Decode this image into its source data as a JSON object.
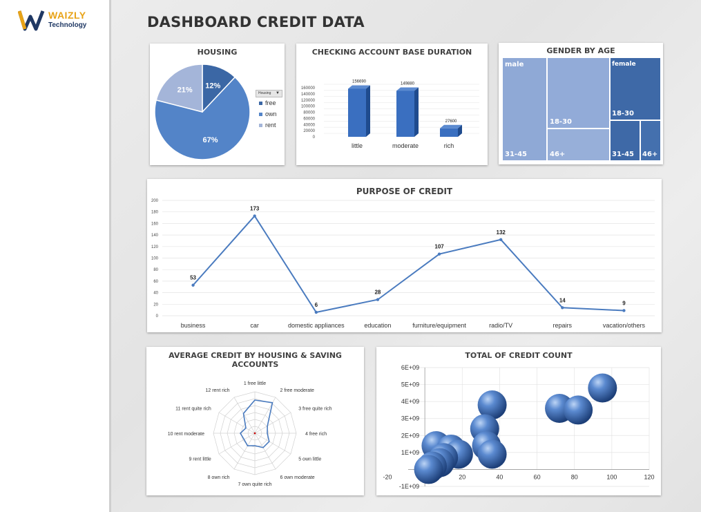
{
  "brand": {
    "name": "WAIZLY",
    "sub": "Technology"
  },
  "page_title": "DASHBOARD CREDIT DATA",
  "colors": {
    "dark_blue": "#3b67a5",
    "mid_blue": "#5384c8",
    "light_blue": "#a4b5d9",
    "line": "#4a7bbf"
  },
  "housing": {
    "title": "HOUSING",
    "filter_label": "Housing",
    "legend": [
      "free",
      "own",
      "rent"
    ]
  },
  "checking": {
    "title": "CHECKING ACCOUNT BASE DURATION"
  },
  "gender": {
    "title": "GENDER BY AGE",
    "labels": {
      "male": "male",
      "female": "female",
      "m_31_45": "31-45",
      "m_18_30": "18-30",
      "m_46": "46+",
      "f_18_30": "18-30",
      "f_31_45": "31-45",
      "f_46": "46+"
    }
  },
  "purpose": {
    "title": "PURPOSE OF CREDIT"
  },
  "radar": {
    "title_line1": "AVERAGE CREDIT BY HOUSING & SAVING",
    "title_line2": "ACCOUNTS"
  },
  "bubble": {
    "title": "TOTAL OF CREDIT COUNT"
  },
  "chart_data": [
    {
      "type": "pie",
      "title": "HOUSING",
      "categories": [
        "free",
        "own",
        "rent"
      ],
      "values": [
        12,
        67,
        21
      ],
      "labels": [
        "12%",
        "67%",
        "21%"
      ],
      "colors": [
        "#3b67a5",
        "#5384c8",
        "#a4b5d9"
      ],
      "legend": "right"
    },
    {
      "type": "bar",
      "title": "CHECKING ACCOUNT BASE DURATION",
      "categories": [
        "little",
        "moderate",
        "rich"
      ],
      "values": [
        156690,
        149880,
        27600
      ],
      "ylim": [
        0,
        160000
      ],
      "yticks": [
        0,
        20000,
        40000,
        60000,
        80000,
        100000,
        120000,
        140000,
        160000
      ],
      "grid": true
    },
    {
      "type": "line",
      "title": "PURPOSE OF CREDIT",
      "categories": [
        "business",
        "car",
        "domestic appliances",
        "education",
        "furniture/equipment",
        "radio/TV",
        "repairs",
        "vacation/others"
      ],
      "values": [
        53,
        173,
        6,
        28,
        107,
        132,
        14,
        9
      ],
      "ylim": [
        0,
        200
      ],
      "yticks": [
        0,
        20,
        40,
        60,
        80,
        100,
        120,
        140,
        160,
        180,
        200
      ],
      "grid": true
    },
    {
      "type": "radar",
      "title": "AVERAGE CREDIT BY HOUSING & SAVING ACCOUNTS",
      "categories": [
        "1 free little",
        "2 free moderate",
        "3 free quite rich",
        "4 free rich",
        "5 own little",
        "6 own moderate",
        "7 own quite rich",
        "8 own rich",
        "9 rent little",
        "10 rent moderate",
        "11 rent quite rich",
        "12 rent rich"
      ],
      "values": [
        0.8,
        0.85,
        0.35,
        0.3,
        0.4,
        0.4,
        0.3,
        0.35,
        0.3,
        0.35,
        0.25,
        0.55
      ],
      "rings": 6
    },
    {
      "type": "scatter",
      "title": "TOTAL OF CREDIT COUNT",
      "xlim": [
        -20,
        120
      ],
      "xticks": [
        -20,
        0,
        20,
        40,
        60,
        80,
        100,
        120
      ],
      "ylim": [
        -1000000000,
        6000000000
      ],
      "yticks": [
        -1000000000,
        0,
        1000000000,
        2000000000,
        3000000000,
        4000000000,
        5000000000,
        6000000000
      ],
      "ytick_labels": [
        "-1E+09",
        "0",
        "1E+09",
        "2E+09",
        "3E+09",
        "4E+09",
        "5E+09",
        "6E+09"
      ],
      "xtick_labels": [
        "-20",
        "0",
        "20",
        "40",
        "60",
        "80",
        "100",
        "120"
      ],
      "points": [
        {
          "x": 95,
          "y": 4800000000
        },
        {
          "x": 72,
          "y": 3600000000
        },
        {
          "x": 82,
          "y": 3500000000
        },
        {
          "x": 36,
          "y": 3800000000
        },
        {
          "x": 32,
          "y": 2400000000
        },
        {
          "x": 33,
          "y": 1400000000
        },
        {
          "x": 36,
          "y": 900000000
        },
        {
          "x": 6,
          "y": 1400000000
        },
        {
          "x": 14,
          "y": 1200000000
        },
        {
          "x": 18,
          "y": 900000000
        },
        {
          "x": 10,
          "y": 700000000
        },
        {
          "x": 8,
          "y": 400000000
        },
        {
          "x": 4,
          "y": 200000000
        },
        {
          "x": 2,
          "y": 0
        }
      ]
    }
  ]
}
